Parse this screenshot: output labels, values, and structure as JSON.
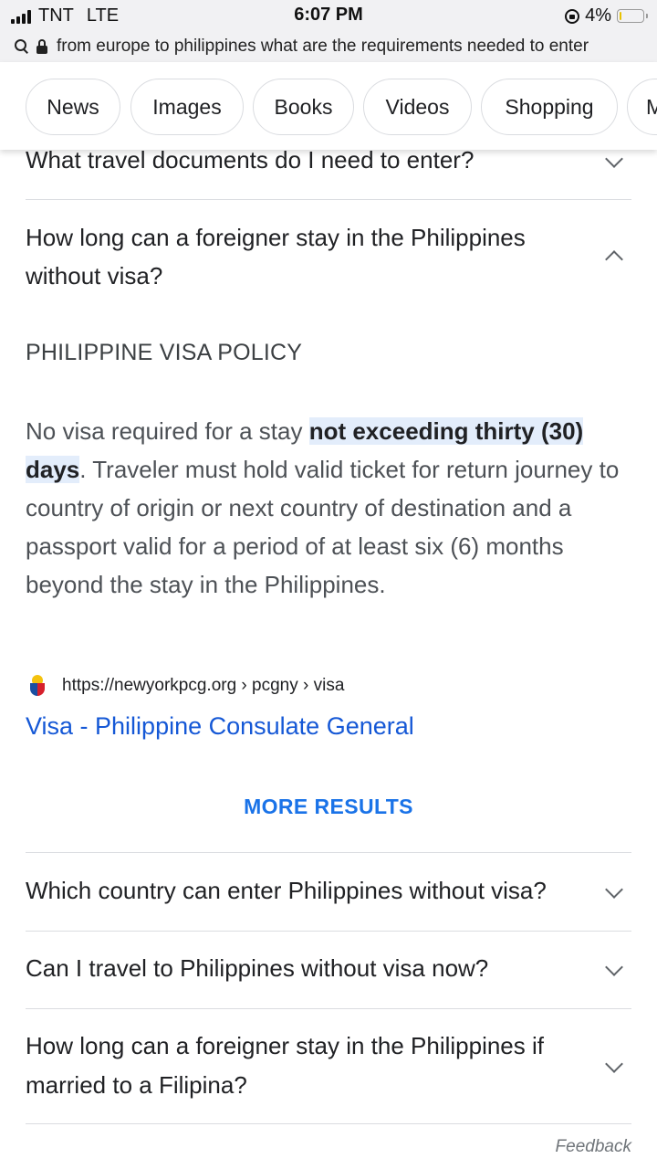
{
  "status_bar": {
    "carrier": "TNT",
    "network": "LTE",
    "time": "6:07 PM",
    "battery": "4%",
    "battery_level": 0.04
  },
  "url_bar": {
    "query": "from europe to philippines what are the requirements needed to enter"
  },
  "chips": [
    "News",
    "Images",
    "Books",
    "Videos",
    "Shopping",
    "M"
  ],
  "faq": {
    "top_question": "What travel documents do I need to enter?",
    "expanded_question_line1": "How long can a foreigner stay in the Philippines",
    "expanded_question_line2": "without visa?",
    "answer_heading": "PHILIPPINE VISA POLICY",
    "answer_prefix": "No visa required for a stay ",
    "answer_highlight": "not exceeding thirty (30) days",
    "answer_suffix": ". Traveler must hold valid ticket for return journey to country of origin or next country of destination and a passport valid for a period of at least six (6) months beyond the stay in the Philippines.",
    "source_url": "https://newyorkpcg.org › pcgny › visa",
    "result_title": "Visa - Philippine Consulate General",
    "more_results": "MORE RESULTS",
    "questions": [
      "Which country can enter Philippines without visa?",
      "Can I travel to Philippines without visa now?",
      "How long can a foreigner stay in the Philippines if married to a Filipina?"
    ]
  },
  "footer": {
    "feedback": "Feedback"
  }
}
